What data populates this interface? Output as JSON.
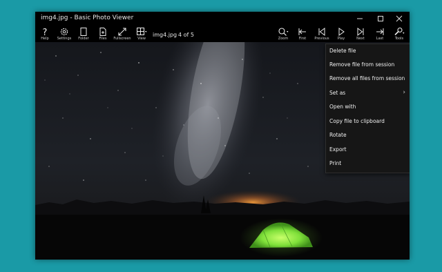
{
  "window": {
    "title": "img4.jpg - Basic Photo Viewer",
    "minimize_icon": "minimize-icon",
    "maximize_icon": "maximize-icon",
    "close_icon": "close-icon"
  },
  "toolbar": {
    "left_buttons": [
      {
        "label": "Help",
        "icon": "help-icon"
      },
      {
        "label": "Settings",
        "icon": "gear-icon"
      },
      {
        "label": "Folder",
        "icon": "folder-icon"
      },
      {
        "label": "Files",
        "icon": "files-icon"
      },
      {
        "label": "Fullscreen",
        "icon": "fullscreen-icon"
      },
      {
        "label": "View",
        "icon": "grid-view-icon"
      }
    ],
    "file_name": "img4.jpg",
    "counter": "4 of 5",
    "right_buttons": [
      {
        "label": "Zoom",
        "icon": "zoom-icon"
      },
      {
        "label": "First",
        "icon": "first-icon"
      },
      {
        "label": "Previous",
        "icon": "previous-icon"
      },
      {
        "label": "Play",
        "icon": "play-icon"
      },
      {
        "label": "Next",
        "icon": "next-icon"
      },
      {
        "label": "Last",
        "icon": "last-icon"
      },
      {
        "label": "Tools",
        "icon": "tools-icon"
      }
    ]
  },
  "tools_menu": {
    "items": [
      {
        "label": "Delete file"
      },
      {
        "label": "Remove file from session"
      },
      {
        "label": "Remove all files from session"
      },
      {
        "label": "Set as",
        "submenu": true
      },
      {
        "label": "Open with"
      },
      {
        "label": "Copy file to clipboard"
      },
      {
        "label": "Rotate"
      },
      {
        "label": "Export"
      },
      {
        "label": "Print"
      }
    ]
  },
  "colors": {
    "desktop": "#1a9aa6",
    "tent": "#7fe03a",
    "horizon_glow": "#e07a2a"
  }
}
